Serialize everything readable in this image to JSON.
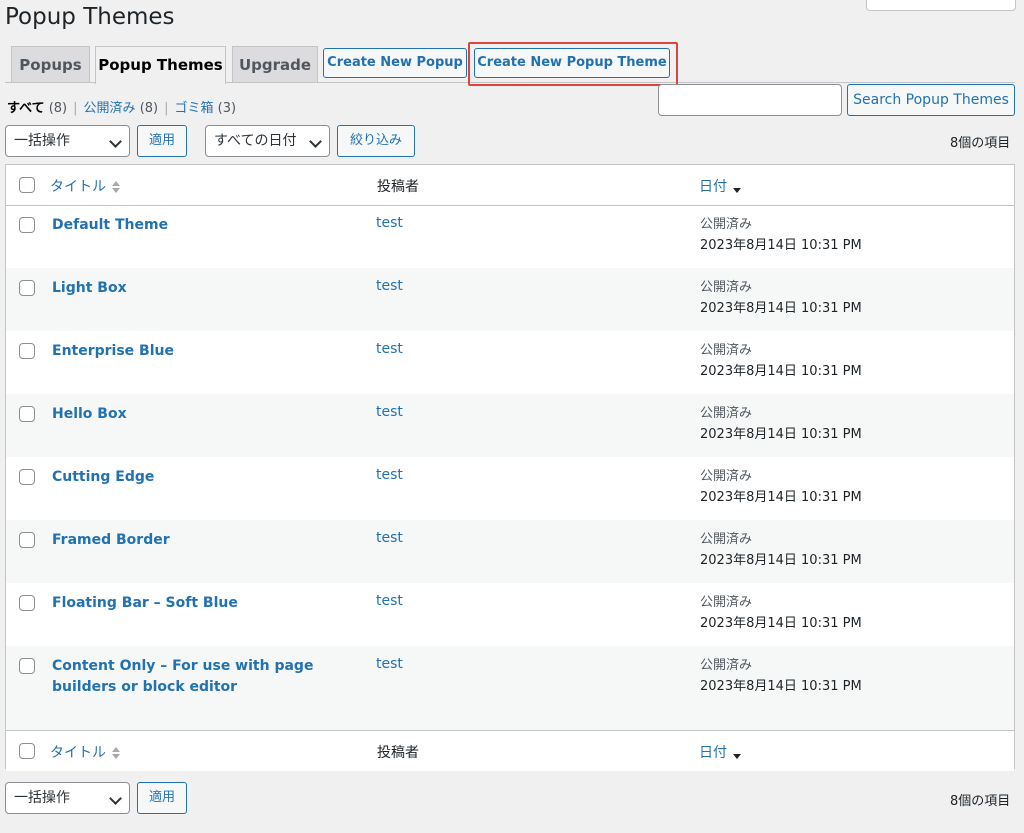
{
  "page": {
    "title": "Popup Themes"
  },
  "tabs": [
    {
      "label": "Popups"
    },
    {
      "label": "Popup Themes"
    },
    {
      "label": "Upgrade"
    }
  ],
  "header_buttons": {
    "create_popup": "Create New Popup",
    "create_theme": "Create New Popup Theme"
  },
  "filters": {
    "all": "すべて",
    "all_count": "(8)",
    "published": "公開済み",
    "published_count": "(8)",
    "trash": "ゴミ箱",
    "trash_count": "(3)"
  },
  "search": {
    "value": "",
    "button": "Search Popup Themes"
  },
  "bulk": {
    "action": "一括操作",
    "apply": "適用",
    "dates": "すべての日付",
    "filter": "絞り込み",
    "count": "8個の項目"
  },
  "table": {
    "columns": {
      "title": "タイトル",
      "author": "投稿者",
      "date": "日付"
    },
    "rows": [
      {
        "title": "Default Theme",
        "author": "test",
        "status": "公開済み",
        "date": "2023年8月14日 10:31 PM"
      },
      {
        "title": "Light Box",
        "author": "test",
        "status": "公開済み",
        "date": "2023年8月14日 10:31 PM"
      },
      {
        "title": "Enterprise Blue",
        "author": "test",
        "status": "公開済み",
        "date": "2023年8月14日 10:31 PM"
      },
      {
        "title": "Hello Box",
        "author": "test",
        "status": "公開済み",
        "date": "2023年8月14日 10:31 PM"
      },
      {
        "title": "Cutting Edge",
        "author": "test",
        "status": "公開済み",
        "date": "2023年8月14日 10:31 PM"
      },
      {
        "title": "Framed Border",
        "author": "test",
        "status": "公開済み",
        "date": "2023年8月14日 10:31 PM"
      },
      {
        "title": "Floating Bar – Soft Blue",
        "author": "test",
        "status": "公開済み",
        "date": "2023年8月14日 10:31 PM"
      },
      {
        "title": "Content Only – For use with page builders or block editor",
        "author": "test",
        "status": "公開済み",
        "date": "2023年8月14日 10:31 PM"
      }
    ]
  },
  "colors": {
    "link": "#2271b1",
    "highlight": "#e0433c",
    "background": "#f0f0f1"
  }
}
